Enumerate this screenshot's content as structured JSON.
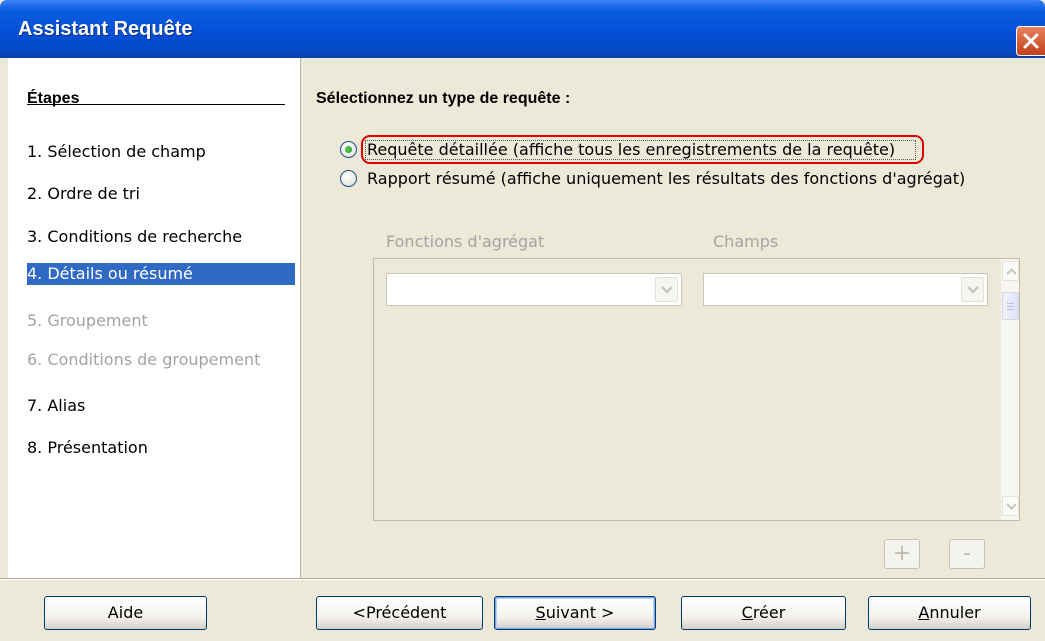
{
  "window": {
    "title": "Assistant Requête"
  },
  "sidebar": {
    "heading": "Étapes",
    "steps": [
      {
        "label": "1.  Sélection de champ",
        "state": "normal"
      },
      {
        "label": "2.  Ordre de tri",
        "state": "normal"
      },
      {
        "label": "3.  Conditions de recherche",
        "state": "normal"
      },
      {
        "label": "4.  Détails ou résumé",
        "state": "selected"
      },
      {
        "label": "5.  Groupement",
        "state": "disabled"
      },
      {
        "label": "6.  Conditions de groupement",
        "state": "disabled"
      },
      {
        "label": "7.  Alias",
        "state": "normal"
      },
      {
        "label": "8.  Présentation",
        "state": "normal"
      }
    ]
  },
  "main": {
    "title": "Sélectionnez un type de requête :",
    "options": [
      {
        "label": "Requête détaillée (affiche tous les enregistrements de la requête)",
        "selected": true
      },
      {
        "label": "Rapport résumé (affiche uniquement les résultats des fonctions d'agrégat)",
        "selected": false
      }
    ],
    "aggregate": {
      "functions_label": "Fonctions d'agrégat",
      "fields_label": "Champs",
      "functions_value": "",
      "fields_value": "",
      "add_label": "+",
      "remove_label": "-"
    }
  },
  "buttons": {
    "help": "Aide",
    "previous": "<Précédent",
    "next_prefix": "S",
    "next_rest": "uivant >",
    "create_prefix": "C",
    "create_rest": "réer",
    "cancel_prefix": "A",
    "cancel_rest": "nnuler"
  },
  "colors": {
    "titlebar": "#0550d8",
    "selection": "#316ac5",
    "highlight_ring": "#e00000",
    "disabled_text": "#a3a3a3"
  },
  "icons": {
    "close": "close-icon",
    "dropdown": "chevron-down-icon",
    "scroll_up": "chevron-up-icon",
    "scroll_down": "chevron-down-icon"
  }
}
